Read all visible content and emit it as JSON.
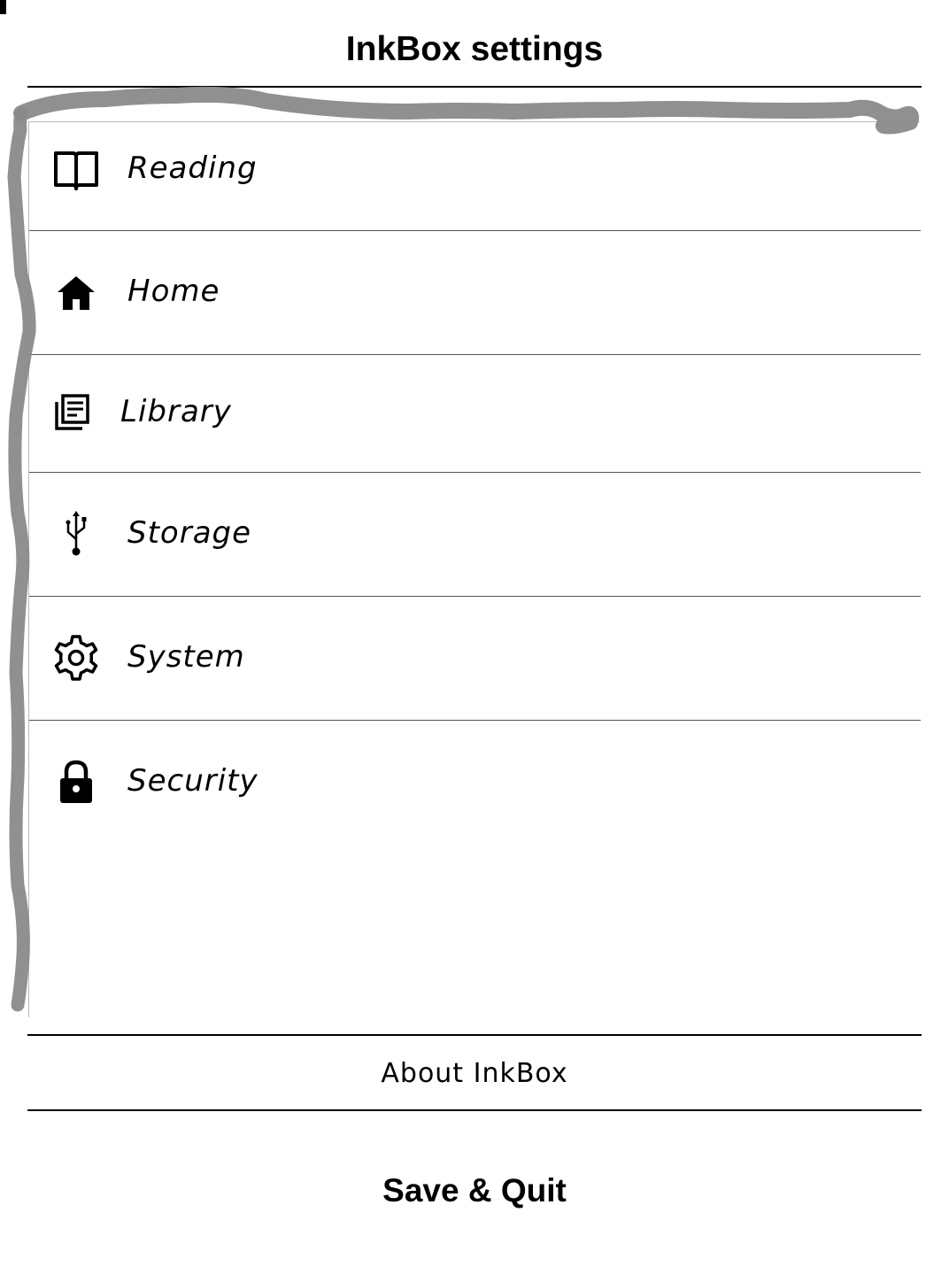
{
  "header": {
    "title": "InkBox settings"
  },
  "menu": {
    "items": [
      {
        "icon": "book-open-icon",
        "label": "Reading"
      },
      {
        "icon": "home-icon",
        "label": "Home"
      },
      {
        "icon": "library-icon",
        "label": "Library"
      },
      {
        "icon": "usb-icon",
        "label": "Storage"
      },
      {
        "icon": "gear-icon",
        "label": "System"
      },
      {
        "icon": "lock-icon",
        "label": "Security"
      }
    ]
  },
  "footer": {
    "about_label": "About InkBox",
    "save_label": "Save & Quit"
  },
  "colors": {
    "background": "#ffffff",
    "text": "#000000",
    "scribble": "#8a8a8a"
  }
}
